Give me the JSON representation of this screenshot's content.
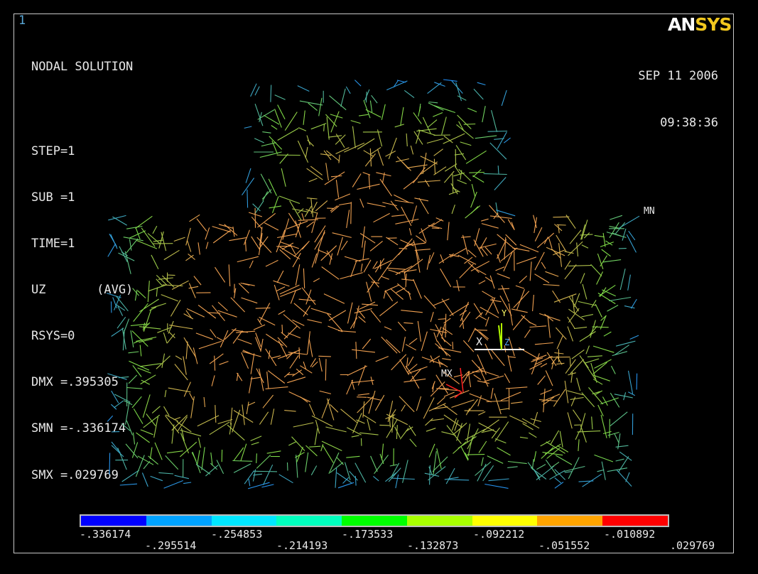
{
  "window_number": "1",
  "header": {
    "title": "NODAL SOLUTION",
    "lines": [
      "STEP=1",
      "SUB =1",
      "TIME=1",
      "UZ       (AVG)",
      "RSYS=0",
      "DMX =.395305",
      "SMN =-.336174",
      "SMX =.029769"
    ]
  },
  "date": "SEP 11 2006",
  "time": "09:38:36",
  "logo": {
    "an": "AN",
    "sys": "SYS"
  },
  "markers": {
    "min": "MN",
    "max": "MX"
  },
  "triad": {
    "x": "X",
    "y": "Y",
    "z": "Z"
  },
  "legend": {
    "colors": [
      "#0000ff",
      "#00a2ff",
      "#00e6ff",
      "#00ffbe",
      "#00ff00",
      "#a8ff00",
      "#ffff00",
      "#ffa400",
      "#ff0000"
    ],
    "top_labels": [
      "-.336174",
      "-.254853",
      "-.173533",
      "-.092212",
      "-.010892"
    ],
    "bottom_labels": [
      "-.295514",
      "-.214193",
      "-.132873",
      "-.051552",
      ".029769"
    ]
  },
  "accent_colors": {
    "mesh_core": "#f0a050",
    "mesh_outer": "#7cdc46",
    "mesh_tip": "#1e8cff"
  }
}
